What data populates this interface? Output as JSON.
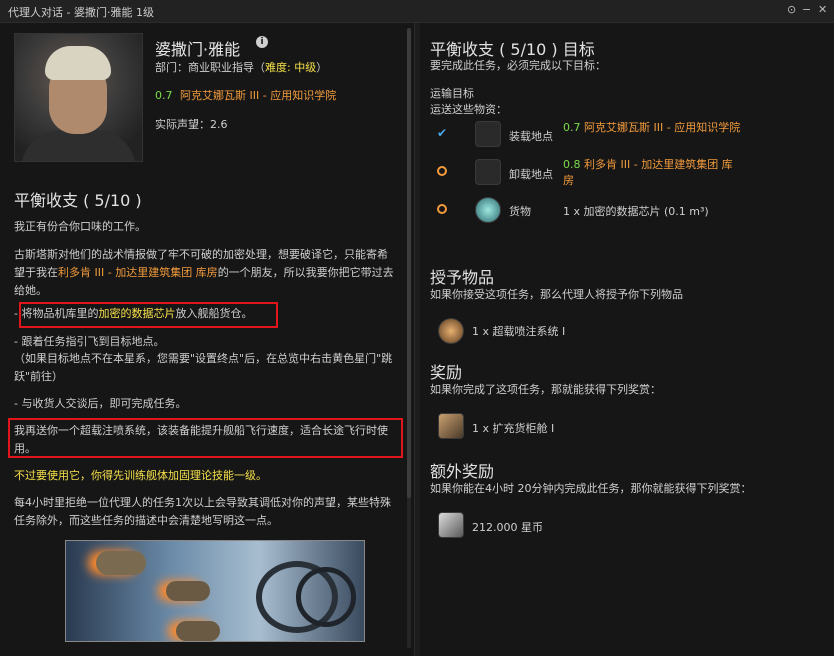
{
  "window": {
    "title": "代理人对话 - 婆撒门·雅能 1级",
    "controls": [
      "⊙",
      "−",
      "✕"
    ]
  },
  "agent": {
    "name": "婆撒门·雅能",
    "division": "部门：商业职业指导（",
    "difficulty": "难度: 中级",
    "division_close": "）",
    "security": "0.7",
    "location": "阿克艾娜瓦斯 III - 应用知识学院",
    "standing": "实际声望：2.6"
  },
  "mission": {
    "title": "平衡收支 ( 5/10 )",
    "p1": "我正有份合你口味的工作。",
    "p2a": "古斯塔斯对他们的战术情报做了牢不可破的加密处理，想要破译它，只能寄希望于我在",
    "p2b": "利多肯 III - 加达里建筑集团 库房",
    "p2c": "的一个朋友，所以我要你把它带过去给她。",
    "step1a": "- 将物品机库里的",
    "step1b": "加密的数据芯片",
    "step1c": "放入舰船货仓。",
    "step2": "- 跟着任务指引飞到目标地点。",
    "step2b": "（如果目标地点不在本星系，您需要\"设置终点\"后，在总览中右击黄色星门\"跳跃\"前往）",
    "step3": "- 与收货人交谈后，即可完成任务。",
    "p3": "我再送你一个超载注喷系统，该装备能提升舰船飞行速度，适合长途飞行时使用。",
    "warning": "不过要使用它，你得先训练舰体加固理论技能一级。",
    "p4": "每4小时里拒绝一位代理人的任务1次以上会导致其调低对你的声望，某些特殊任务除外，而这些任务的描述中会清楚地写明这一点。"
  },
  "objectives": {
    "title": "平衡收支 ( 5/10 ) 目标",
    "subtitle": "要完成此任务，必须完成以下目标：",
    "transport_header": "运输目标",
    "transport_sub": "运送这些物资：",
    "rows": [
      {
        "label": "装载地点",
        "sec": "0.7",
        "value": "阿克艾娜瓦斯 III - 应用知识学院"
      },
      {
        "label": "卸载地点",
        "sec": "0.8",
        "value": "利多肯 III - 加达里建筑集团 库房"
      },
      {
        "label": "货物",
        "sec": "",
        "value": "1 x 加密的数据芯片 (0.1 m³)"
      }
    ]
  },
  "granted": {
    "title": "授予物品",
    "subtitle": "如果你接受这项任务，那么代理人将授予你下列物品",
    "item": "1 x 超载喷注系统 I"
  },
  "reward": {
    "title": "奖励",
    "subtitle": "如果你完成了这项任务，那就能获得下列奖赏：",
    "item": "1 x 扩充货柜舱 I"
  },
  "bonus": {
    "title": "额外奖励",
    "subtitle": "如果你能在4小时 20分钟内完成此任务，那你就能获得下列奖赏：",
    "item": "212.000 星币"
  },
  "colors": {
    "highlight_yellow": "#f5e04a",
    "link_orange": "#f29b3c",
    "sec_green": "#7bdc4a",
    "annotation_red": "#e0161c"
  }
}
